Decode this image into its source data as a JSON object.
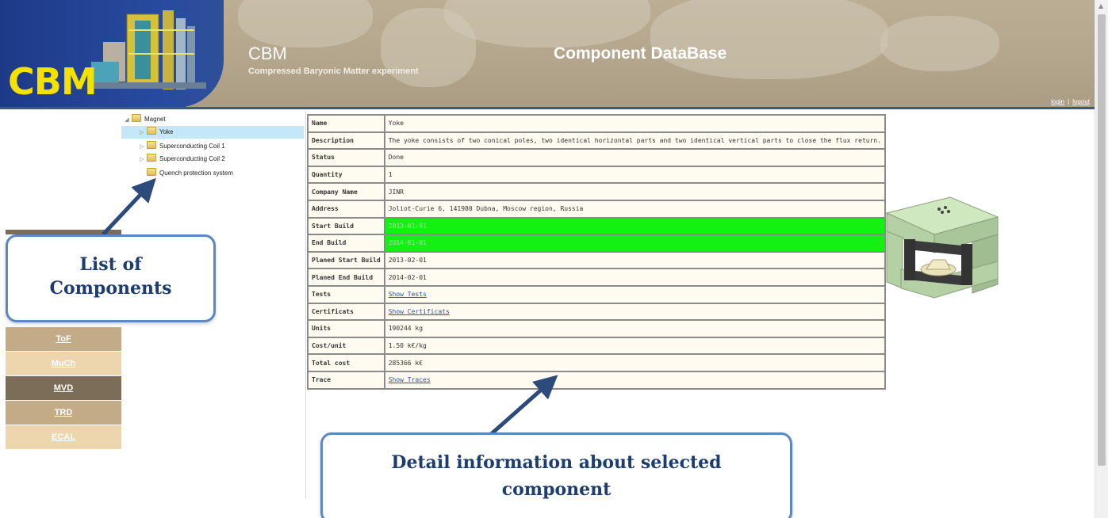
{
  "header": {
    "logo_text": "CBM",
    "app_name": "CBM",
    "subtitle": "Compressed Baryonic Matter experiment",
    "title": "Component DataBase",
    "login_label": "login",
    "logout_label": "logout",
    "separator": "|"
  },
  "tree": {
    "root": {
      "label": "Magnet",
      "toggle": "◢"
    },
    "children": [
      {
        "label": "Yoke",
        "toggle": "▷",
        "selected": true
      },
      {
        "label": "Superconducting Coil 1",
        "toggle": "▷"
      },
      {
        "label": "Superconducting Coil 2",
        "toggle": "▷"
      },
      {
        "label": "Quench protection system",
        "toggle": ""
      }
    ]
  },
  "nav": {
    "items": [
      {
        "label": "ToF",
        "bg": "#c4ab87",
        "color": "#ffffff"
      },
      {
        "label": "MuCh",
        "bg": "#edd6ae",
        "color": "#ffffff"
      },
      {
        "label": "MVD",
        "bg": "#7c6d58",
        "color": "#ffffff"
      },
      {
        "label": "TRD",
        "bg": "#c4ab87",
        "color": "#ffffff"
      },
      {
        "label": "ECAL",
        "bg": "#edd6ae",
        "color": "#ffffff"
      }
    ]
  },
  "details": {
    "rows": [
      {
        "label": "Name",
        "value": "Yoke"
      },
      {
        "label": "Description",
        "value": "The yoke consists of two conical poles, two identical horizontal parts and two identical vertical parts to close the flux return."
      },
      {
        "label": "Status",
        "value": "Done"
      },
      {
        "label": "Quantity",
        "value": "1"
      },
      {
        "label": "Company Name",
        "value": "JINR"
      },
      {
        "label": "Address",
        "value": "Joliot-Curie 6, 141980 Dubna, Moscow region, Russia"
      },
      {
        "label": "Start Build",
        "value": "2013-01-01",
        "highlight": true
      },
      {
        "label": "End Build",
        "value": "2014-01-01",
        "highlight": true
      },
      {
        "label": "Planed Start Build",
        "value": "2013-02-01"
      },
      {
        "label": "Planed End Build",
        "value": "2014-02-01"
      },
      {
        "label": "Tests",
        "value": "Show Tests",
        "link": true
      },
      {
        "label": "Certificats",
        "value": "Show Certificats",
        "link": true
      },
      {
        "label": "Units",
        "value": "190244 kg"
      },
      {
        "label": "Cost/unit",
        "value": "1.50 k€/kg"
      },
      {
        "label": "Total cost",
        "value": "285366 k€"
      },
      {
        "label": "Trace",
        "value": "Show Traces",
        "link": true
      }
    ],
    "highlight_color": "#13f113"
  },
  "callouts": {
    "list": {
      "line1": "List of",
      "line2": "Components"
    },
    "detail": {
      "line1": "Detail information about selected",
      "line2": "component"
    }
  },
  "colors": {
    "header_bg": "#b4a68c",
    "header_rule": "#3b5a7e",
    "logo_bg": "#284a9e",
    "logo_text": "#f4e100",
    "callout_border": "#5b87c2",
    "callout_text": "#1d3d6e",
    "arrow": "#2c4a7a",
    "link": "#2a4fb5"
  }
}
